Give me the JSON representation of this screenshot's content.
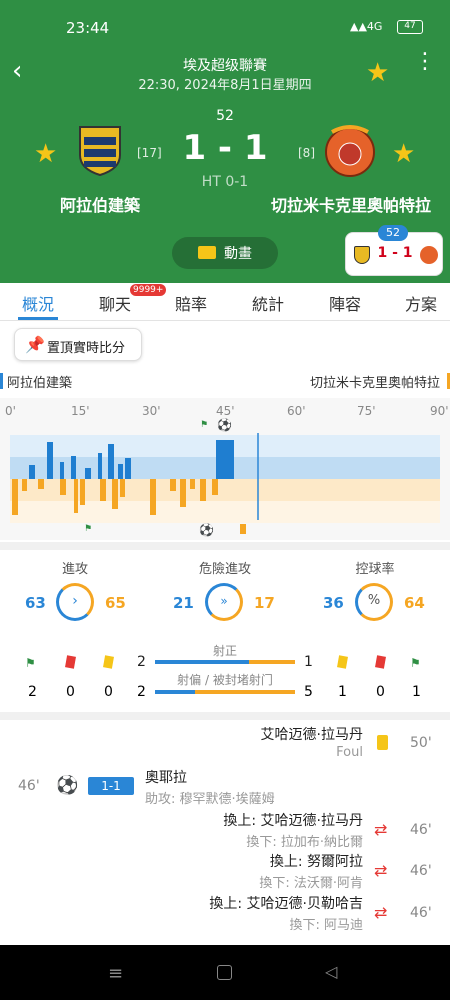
{
  "status_bar": {
    "time": "23:44",
    "signal_text": "4G",
    "battery": "47"
  },
  "header": {
    "league": "埃及超级聯賽",
    "datetime": "22:30, 2024年8月1日星期四",
    "minute": "52",
    "score": "1 - 1",
    "ht": "HT 0-1",
    "home": {
      "name": "阿拉伯建築",
      "rank": "[17]"
    },
    "away": {
      "name": "切拉米卡克里奧帕特拉",
      "rank": "[8]"
    },
    "animation_label": "動畫",
    "mini": {
      "minute": "52",
      "score": "1 - 1"
    }
  },
  "tabs": [
    {
      "label": "概況"
    },
    {
      "label": "聊天",
      "badge": "9999+"
    },
    {
      "label": "賠率"
    },
    {
      "label": "統計"
    },
    {
      "label": "陣容"
    },
    {
      "label": "方案"
    }
  ],
  "pin_button": "置頂實時比分",
  "timeline": {
    "home_name": "阿拉伯建築",
    "away_name": "切拉米卡克里奧帕特拉",
    "ticks": [
      "0'",
      "15'",
      "30'",
      "45'",
      "60'",
      "75'",
      "90'"
    ]
  },
  "stats": {
    "attack": {
      "label": "進攻",
      "home": "63",
      "away": "65"
    },
    "dangerous": {
      "label": "危險進攻",
      "home": "21",
      "away": "17"
    },
    "possession": {
      "label": "控球率",
      "home": "36",
      "away": "64"
    },
    "on_target_label": "射正",
    "off_target_label": "射偏 / 被封堵射门",
    "home_counts": {
      "corners": "2",
      "red": "0",
      "yellow": "0",
      "on_target": "2",
      "off_target": "2"
    },
    "away_counts": {
      "on_target": "1",
      "off_target": "5",
      "yellow": "1",
      "red": "0",
      "corners": "1"
    }
  },
  "events": [
    {
      "side": "away",
      "player": "艾哈迈德·拉马丹",
      "sub": "Foul",
      "minute": "50'"
    },
    {
      "side": "home",
      "player": "奧耶拉",
      "sub": "助攻: 穆罕默德·埃薩姆",
      "minute": "46'",
      "score": "1-1"
    },
    {
      "side": "away",
      "player": "換上: 艾哈迈德·拉马丹",
      "sub": "換下: 拉加布·納比爾",
      "minute": "46'"
    },
    {
      "side": "away",
      "player": "換上: 努爾阿拉",
      "sub": "換下: 法沃爾·阿肯",
      "minute": "46'"
    },
    {
      "side": "away",
      "player": "換上: 艾哈迈德·贝勒哈吉",
      "sub": "換下: 阿马迪",
      "minute": "46'"
    }
  ]
}
